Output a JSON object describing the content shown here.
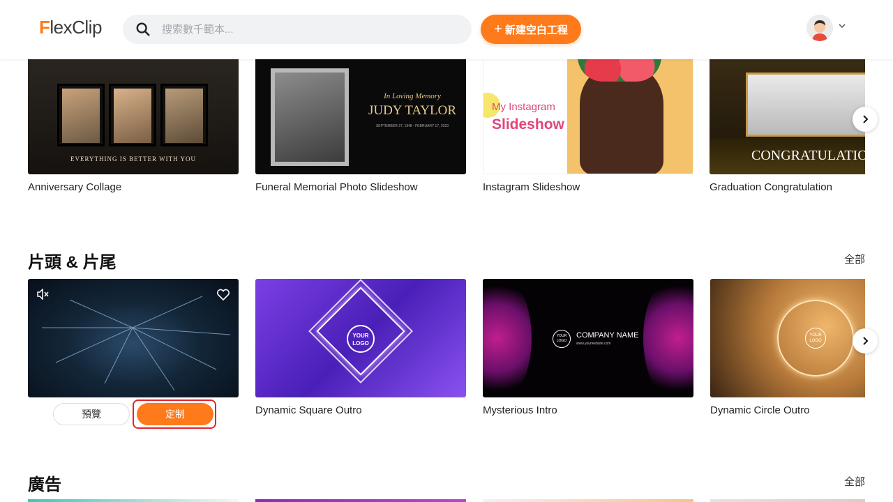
{
  "header": {
    "logo_prefix": "F",
    "logo_rest": "lexClip",
    "search_placeholder": "搜索數千範本...",
    "new_project_label": "新建空白工程"
  },
  "row1": {
    "cards": [
      {
        "title": "Anniversary Collage",
        "caption": "EVERYTHING IS BETTER WITH YOU"
      },
      {
        "title": "Funeral Memorial Photo Slideshow",
        "memory": "In Loving Memory",
        "name": "JUDY TAYLOR",
        "dates": "SEPTEMBER 27, 1948 - FEBRUARY 17, 2023"
      },
      {
        "title": "Instagram Slideshow",
        "line1": "My Instagram",
        "line2": "Slideshow"
      },
      {
        "title": "Graduation Congratulation",
        "banner": "CONGRATULATION"
      }
    ]
  },
  "intro_section": {
    "title": "片頭 & 片尾",
    "see_all": "全部",
    "cards": [
      {
        "title": ""
      },
      {
        "title": "Dynamic Square Outro",
        "logo1": "YOUR",
        "logo2": "LOGO"
      },
      {
        "title": "Mysterious Intro",
        "logo1": "YOUR",
        "logo2": "LOGO",
        "company": "COMPANY NAME",
        "site": "www.yourwebsite.com"
      },
      {
        "title": "Dynamic Circle Outro",
        "logo1": "YOUR",
        "logo2": "LOGO"
      }
    ],
    "preview_label": "預覽",
    "customize_label": "定制"
  },
  "ads_section": {
    "title": "廣告",
    "see_all": "全部"
  },
  "colors": {
    "accent": "#ff7a1a",
    "highlight": "#e3242b"
  }
}
